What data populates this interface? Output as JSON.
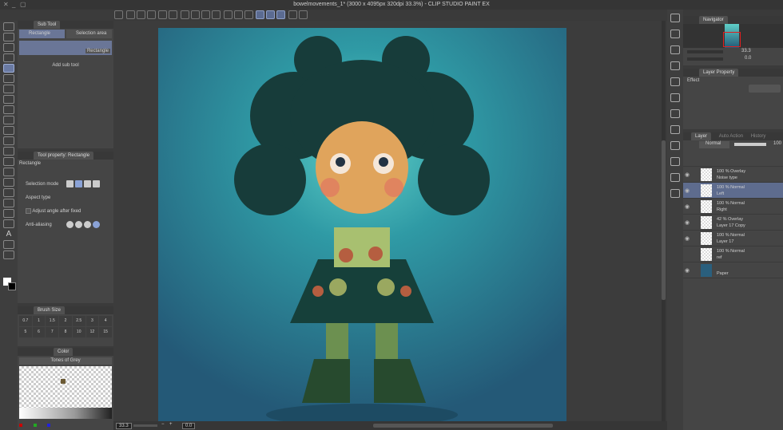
{
  "window": {
    "title": "bowelmovements_1* (3000 x 4095px 320dpi 33.3%) - CLIP STUDIO PAINT EX"
  },
  "subtool": {
    "header": "Sub Tool",
    "tabs": [
      "Rectangle",
      "Selection area"
    ],
    "selected": "Rectangle",
    "add_label": "Add sub tool"
  },
  "toolprop": {
    "header": "Tool property: Rectangle",
    "name": "Rectangle",
    "selection_mode": "Selection mode",
    "aspect_type": "Aspect type",
    "adjust_angle": "Adjust angle after fixed",
    "anti_aliasing": "Anti-aliasing"
  },
  "brushsize": {
    "header": "Brush Size",
    "sizes": [
      "0.7",
      "1",
      "1.5",
      "2",
      "2.5",
      "3",
      "4",
      "5",
      "6",
      "7",
      "8",
      "10",
      "12",
      "15"
    ]
  },
  "color": {
    "tab": "Color",
    "set_name": "Tones of Grey",
    "selected_swatch": "#6b5a34"
  },
  "navigator": {
    "header": "Navigator",
    "zoom": "33.3",
    "angle": "0.0"
  },
  "layerprop": {
    "header": "Layer Property",
    "effect": "Effect"
  },
  "layers": {
    "tabs": [
      "Layer",
      "Auto Action",
      "History"
    ],
    "blend_mode": "Normal",
    "opacity": "100",
    "items": [
      {
        "l1": "100 % Overlay",
        "l2": "Noise type"
      },
      {
        "l1": "100 % Normal",
        "l2": "Left"
      },
      {
        "l1": "100 % Normal",
        "l2": "Right"
      },
      {
        "l1": "42 % Overlay",
        "l2": "Layer 17 Copy"
      },
      {
        "l1": "100 % Normal",
        "l2": "Layer 17"
      },
      {
        "l1": "100 % Normal",
        "l2": "ref"
      },
      {
        "l1": "",
        "l2": "Paper"
      }
    ]
  },
  "status": {
    "zoom": "33.3",
    "angle": "0.0"
  }
}
